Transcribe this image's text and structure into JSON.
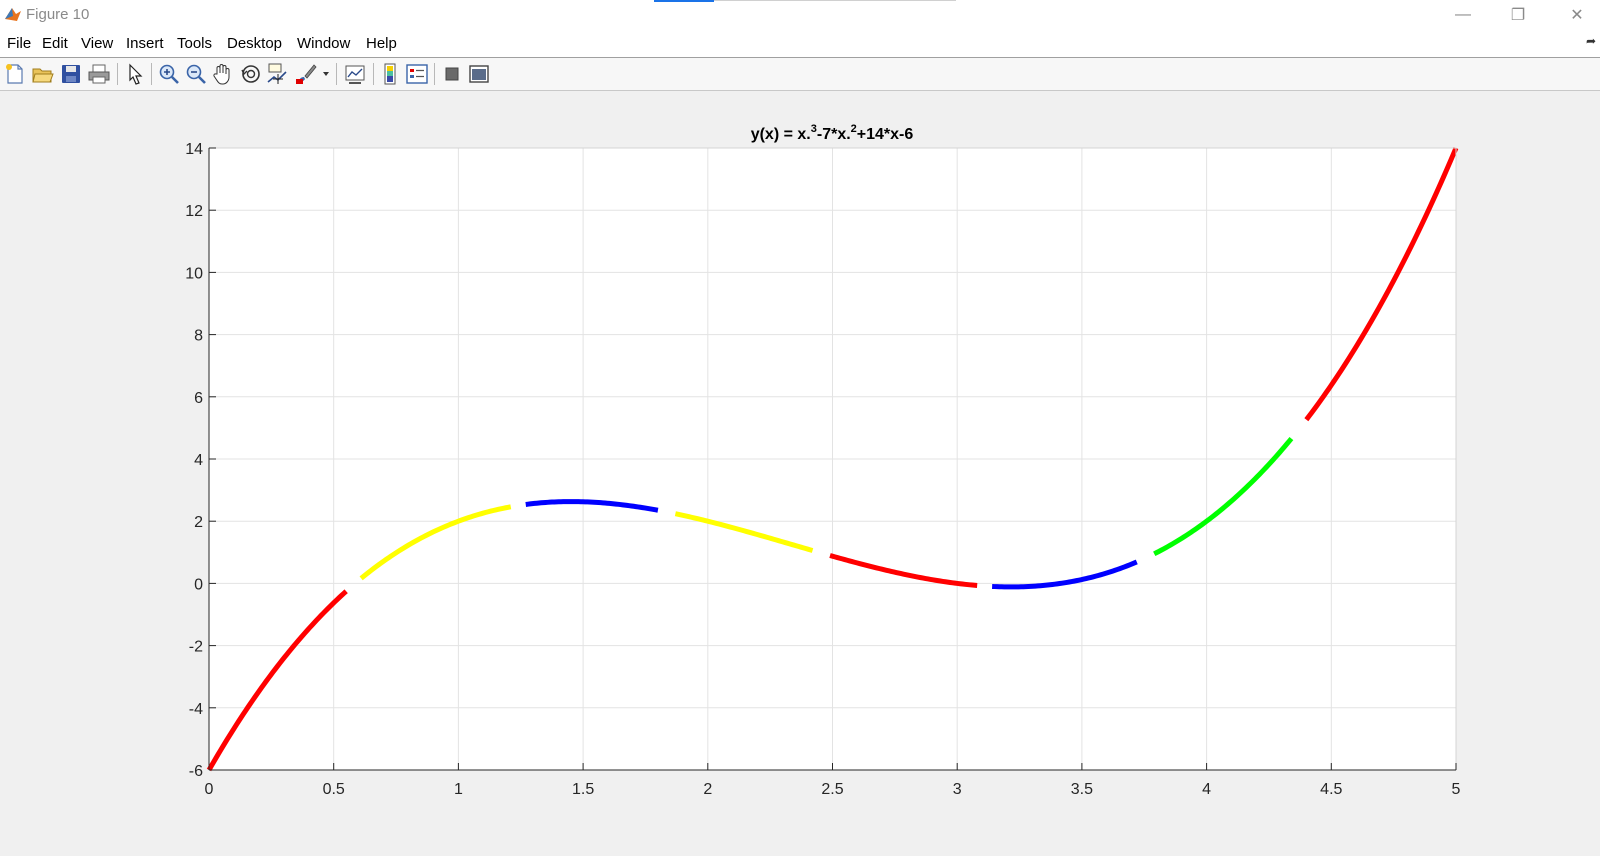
{
  "window": {
    "title": "Figure 10",
    "minimize_glyph": "—",
    "restore_glyph": "❐",
    "close_glyph": "✕"
  },
  "menu": {
    "items": [
      "File",
      "Edit",
      "View",
      "Insert",
      "Tools",
      "Desktop",
      "Window",
      "Help"
    ],
    "pin_glyph": "➦"
  },
  "toolbar": {
    "buttons": [
      "new-figure-icon",
      "open-file-icon",
      "save-icon",
      "print-icon",
      "select-arrow-icon",
      "zoom-in-icon",
      "zoom-out-icon",
      "pan-hand-icon",
      "rotate-3d-icon",
      "data-cursor-icon",
      "brush-icon",
      "link-plot-icon",
      "colorbar-icon",
      "legend-icon",
      "hide-plot-tools-icon",
      "show-plot-tools-icon"
    ]
  },
  "chart_data": {
    "type": "line",
    "title": "y(x) = x.^3-7*x.^2+14*x-6",
    "title_parts": {
      "p1": "y(x) = x.",
      "sup1": "3",
      "p2": "-7*x.",
      "sup2": "2",
      "p3": "+14*x-6"
    },
    "function": "x^3-7*x^2+14*x-6",
    "xlim": [
      0,
      5
    ],
    "ylim": [
      -6,
      14
    ],
    "x_ticks": [
      "0",
      "0.5",
      "1",
      "1.5",
      "2",
      "2.5",
      "3",
      "3.5",
      "4",
      "4.5",
      "5"
    ],
    "y_ticks": [
      "-6",
      "-4",
      "-2",
      "0",
      "2",
      "4",
      "6",
      "8",
      "10",
      "12",
      "14"
    ],
    "grid": true,
    "segments": [
      {
        "color": "#ff0000",
        "x": [
          0.0,
          0.55
        ]
      },
      {
        "color": "#ffff00",
        "x": [
          0.61,
          1.21
        ]
      },
      {
        "color": "#0000ff",
        "x": [
          1.27,
          1.8
        ]
      },
      {
        "color": "#ffff00",
        "x": [
          1.87,
          2.42
        ]
      },
      {
        "color": "#ff0000",
        "x": [
          2.49,
          3.08
        ]
      },
      {
        "color": "#0000ff",
        "x": [
          3.14,
          3.72
        ]
      },
      {
        "color": "#00ff00",
        "x": [
          3.79,
          4.34
        ]
      },
      {
        "color": "#ff0000",
        "x": [
          4.4,
          5.0
        ]
      }
    ]
  }
}
